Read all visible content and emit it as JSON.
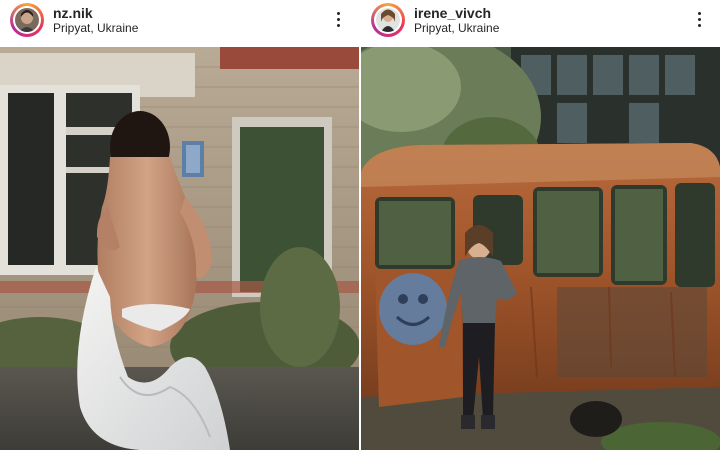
{
  "posts": [
    {
      "username": "nz.nik",
      "location": "Pripyat, Ukraine",
      "icons": {
        "more": "more-vertical-icon"
      },
      "photo": "woman-in-white-sheet-abandoned-building"
    },
    {
      "username": "irene_vivch",
      "location": "Pripyat, Ukraine",
      "icons": {
        "more": "more-vertical-icon"
      },
      "photo": "woman-by-rusty-bus"
    }
  ],
  "colors": {
    "story_ring_start": "#f9a53a",
    "story_ring_mid": "#e8305b",
    "story_ring_end": "#b52e9c",
    "text": "#262626",
    "rust": "#a0552a"
  }
}
